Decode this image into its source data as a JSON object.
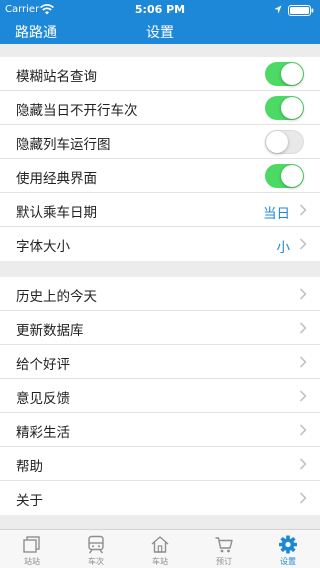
{
  "status_bar": {
    "carrier": "Carrier",
    "time": "5:06 PM"
  },
  "nav": {
    "left_title": "路路通",
    "title": "设置"
  },
  "settings_toggles": [
    {
      "label": "模糊站名查询",
      "on": true
    },
    {
      "label": "隐藏当日不开行车次",
      "on": true
    },
    {
      "label": "隐藏列车运行图",
      "on": false
    },
    {
      "label": "使用经典界面",
      "on": true
    }
  ],
  "settings_values": [
    {
      "label": "默认乘车日期",
      "value": "当日"
    },
    {
      "label": "字体大小",
      "value": "小"
    }
  ],
  "more": [
    {
      "label": "历史上的今天"
    },
    {
      "label": "更新数据库"
    },
    {
      "label": "给个好评"
    },
    {
      "label": "意见反馈"
    },
    {
      "label": "精彩生活"
    },
    {
      "label": "帮助"
    },
    {
      "label": "关于"
    }
  ],
  "tabs": [
    {
      "label": "站站",
      "icon": "station-to-station-icon"
    },
    {
      "label": "车次",
      "icon": "train-icon"
    },
    {
      "label": "车站",
      "icon": "station-house-icon"
    },
    {
      "label": "预订",
      "icon": "cart-icon"
    },
    {
      "label": "设置",
      "icon": "gear-icon",
      "active": true
    }
  ],
  "colors": {
    "accent": "#1e88d8",
    "toggle_on": "#4cd964",
    "background": "#ececec"
  }
}
